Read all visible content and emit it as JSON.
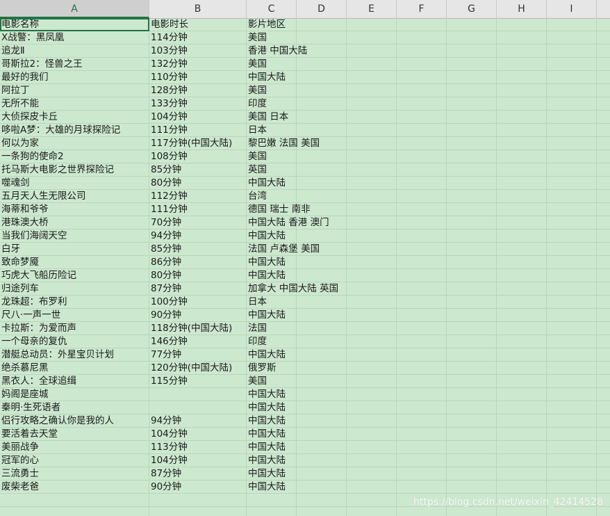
{
  "columns": [
    "A",
    "B",
    "C",
    "D",
    "E",
    "F",
    "G",
    "H",
    "I"
  ],
  "selected_column": "A",
  "rows": [
    [
      "电影名称",
      "电影时长",
      "影片地区"
    ],
    [
      "X战警：黑凤凰",
      "114分钟",
      "美国"
    ],
    [
      "追龙Ⅱ",
      "103分钟",
      "香港 中国大陆"
    ],
    [
      "哥斯拉2：怪兽之王",
      "132分钟",
      "美国"
    ],
    [
      "最好的我们",
      "110分钟",
      "中国大陆"
    ],
    [
      "阿拉丁",
      "128分钟",
      "美国"
    ],
    [
      "无所不能",
      "133分钟",
      "印度"
    ],
    [
      "大侦探皮卡丘",
      "104分钟",
      "美国 日本"
    ],
    [
      "哆啦A梦：大雄的月球探险记",
      "111分钟",
      "日本"
    ],
    [
      "何以为家",
      "117分钟(中国大陆)",
      "黎巴嫩 法国 美国"
    ],
    [
      "一条狗的使命2",
      "108分钟",
      "美国"
    ],
    [
      "托马斯大电影之世界探险记",
      "85分钟",
      "英国"
    ],
    [
      "噬魂剑",
      "80分钟",
      "中国大陆"
    ],
    [
      "五月天人生无限公司",
      "112分钟",
      "台湾"
    ],
    [
      "海蒂和爷爷",
      "111分钟",
      "德国 瑞士 南非"
    ],
    [
      "港珠澳大桥",
      "70分钟",
      "中国大陆 香港 澳门"
    ],
    [
      "当我们海阔天空",
      "94分钟",
      "中国大陆"
    ],
    [
      "白牙",
      "85分钟",
      "法国 卢森堡 美国"
    ],
    [
      "致命梦魇",
      "86分钟",
      "中国大陆"
    ],
    [
      "巧虎大飞船历险记",
      "80分钟",
      "中国大陆"
    ],
    [
      "归途列车",
      "87分钟",
      "加拿大 中国大陆 英国"
    ],
    [
      "龙珠超：布罗利",
      "100分钟",
      "日本"
    ],
    [
      "尺八·一声一世",
      "90分钟",
      "中国大陆"
    ],
    [
      "卡拉斯：为爱而声",
      "118分钟(中国大陆)",
      "法国"
    ],
    [
      "一个母亲的复仇",
      "146分钟",
      "印度"
    ],
    [
      "潜艇总动员：外星宝贝计划",
      "77分钟",
      "中国大陆"
    ],
    [
      "绝杀慕尼黑",
      "120分钟(中国大陆)",
      "俄罗斯"
    ],
    [
      "黑衣人：全球追缉",
      "115分钟",
      "美国"
    ],
    [
      "妈阁是座城",
      "",
      "中国大陆"
    ],
    [
      "秦明·生死语者",
      "",
      "中国大陆"
    ],
    [
      "侣行攻略之确认你是我的人",
      "94分钟",
      "中国大陆"
    ],
    [
      "要活着去天堂",
      "104分钟",
      "中国大陆"
    ],
    [
      "美丽战争",
      "113分钟",
      "中国大陆"
    ],
    [
      "冠军的心",
      "104分钟",
      "中国大陆"
    ],
    [
      "三流勇士",
      "87分钟",
      "中国大陆"
    ],
    [
      "废柴老爸",
      "90分钟",
      "中国大陆"
    ],
    [
      "",
      "",
      ""
    ],
    [
      "",
      "",
      ""
    ]
  ],
  "watermark": "https://blog.csdn.net/weixin_42414528",
  "colors": {
    "sheet_bg": "#cce8cf",
    "gridline": "#b9d6bc",
    "header_bg": "#e6e6e6",
    "accent": "#217346"
  }
}
